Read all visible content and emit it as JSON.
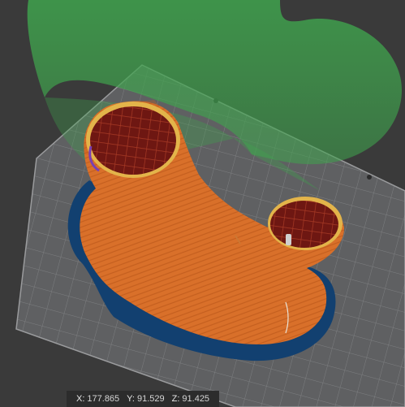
{
  "viewport": {
    "name": "3d-print-preview",
    "colors": {
      "background": "#3a3a3a",
      "bed": "#5f6062",
      "bed_grid": "#8a8b8d",
      "model": "#d9702a",
      "infill": "#6e1712",
      "brim": "#124070",
      "travel_volume": "#3fa34d"
    }
  },
  "coordinates": {
    "x_label": "X:",
    "x_value": "177.865",
    "y_label": "Y:",
    "y_value": "91.529",
    "z_label": "Z:",
    "z_value": "91.425"
  }
}
